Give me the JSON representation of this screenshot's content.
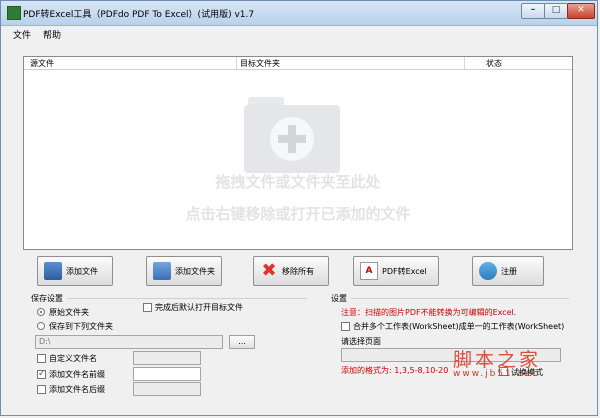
{
  "window": {
    "title": "PDF转Excel工具（PDFdo PDF To Excel）(试用版) v1.7",
    "min": "–",
    "max": "□",
    "close": "✕"
  },
  "menu": {
    "file": "文件",
    "help": "帮助"
  },
  "list": {
    "columns": [
      "源文件",
      "目标文件夹",
      "状态"
    ],
    "hint1": "拖拽文件或文件夹至此处",
    "hint2": "点击右键移除或打开已添加的文件"
  },
  "buttons": {
    "add_file": "添加文件",
    "add_folder": "添加文件夹",
    "remove_all": "移除所有",
    "convert": "PDF转Excel",
    "register": "注册"
  },
  "save": {
    "group": "保存设置",
    "original_folder": "原始文件夹",
    "to_folder": "保存到下列文件夹",
    "open_after": "完成后默认打开目标文件",
    "path": "D:\\",
    "browse": "...",
    "custom_name": "自定义文件名",
    "add_prefix": "添加文件名前缀",
    "add_suffix": "添加文件名后缀"
  },
  "settings": {
    "group": "设置",
    "note": "注意：扫描的图片PDF不能转换为可编辑的Excel.",
    "merge": "合并多个工作表(WorkSheet)成单一的工作表(WorkSheet)",
    "choose_page": "请选择页面",
    "format": "添加的格式为: 1,3,5-8,10-20",
    "mode": "试换模式"
  },
  "watermark": {
    "logo": "脚本之家",
    "url": "www.jb51.net"
  }
}
